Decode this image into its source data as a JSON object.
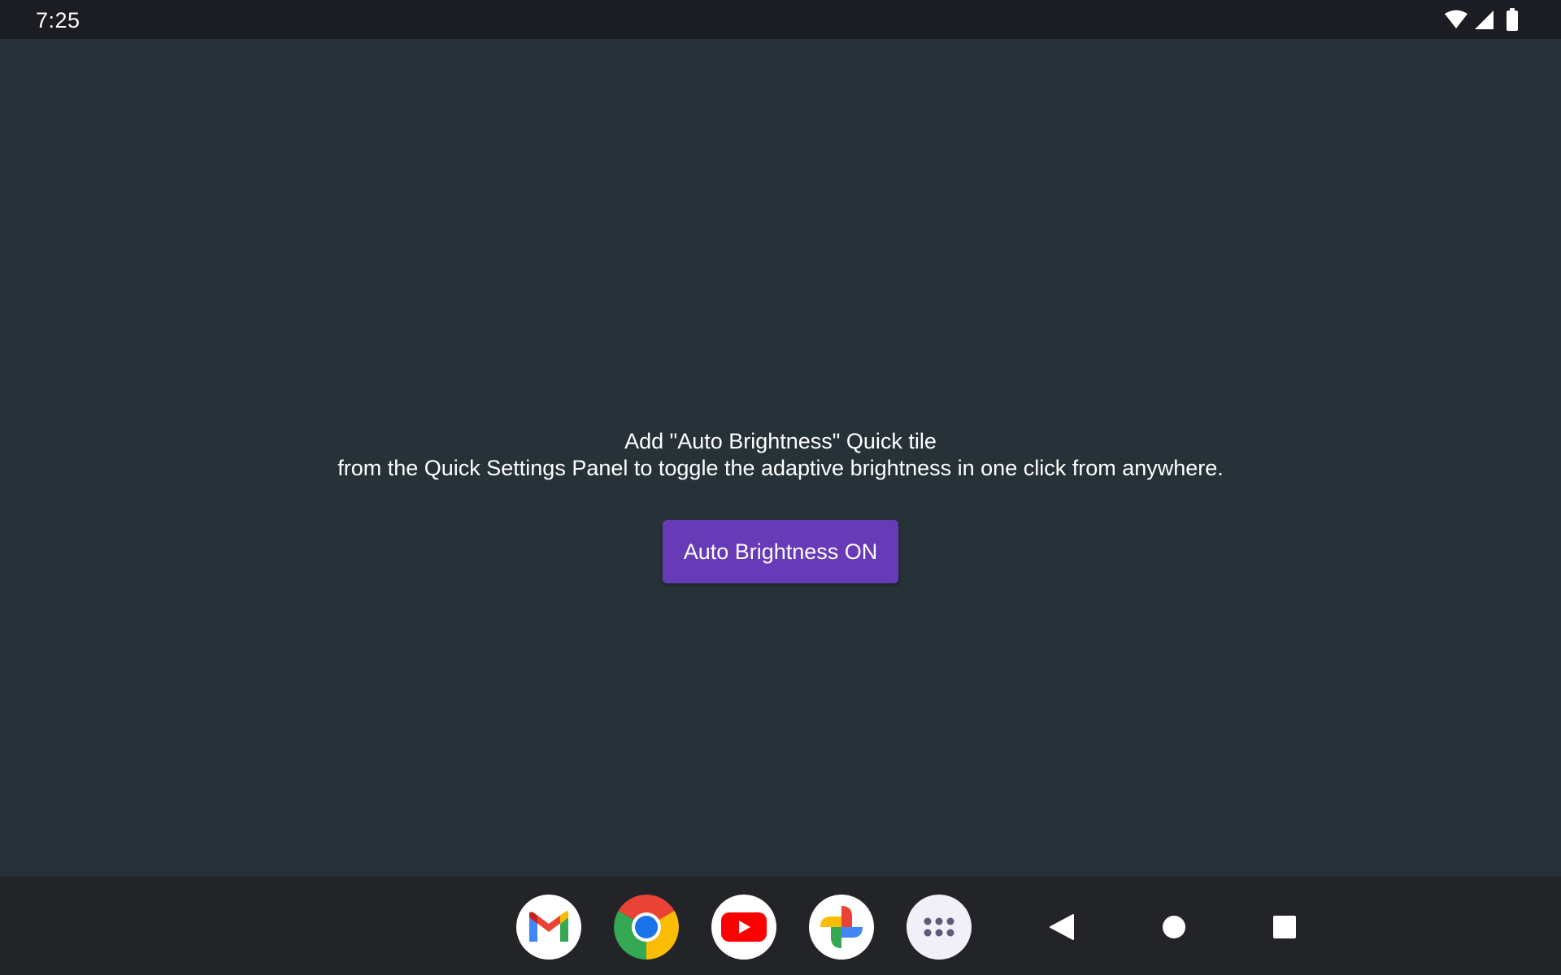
{
  "status_bar": {
    "time": "7:25",
    "icons": [
      "wifi-icon",
      "cell-signal-icon",
      "battery-icon"
    ]
  },
  "main": {
    "instruction_line1": "Add \"Auto Brightness\" Quick tile",
    "instruction_line2": "from the Quick Settings Panel to toggle the adaptive brightness in one click from anywhere.",
    "button_label": "Auto Brightness ON"
  },
  "dock": {
    "apps": [
      "gmail-icon",
      "chrome-icon",
      "youtube-icon",
      "photos-icon",
      "app-drawer-icon"
    ]
  },
  "navigation": {
    "buttons": [
      "back-icon",
      "home-icon",
      "recents-icon"
    ]
  },
  "colors": {
    "background": "#263238",
    "status_bar": "#1c1d22",
    "taskbar": "#232428",
    "button": "#673ab7"
  }
}
